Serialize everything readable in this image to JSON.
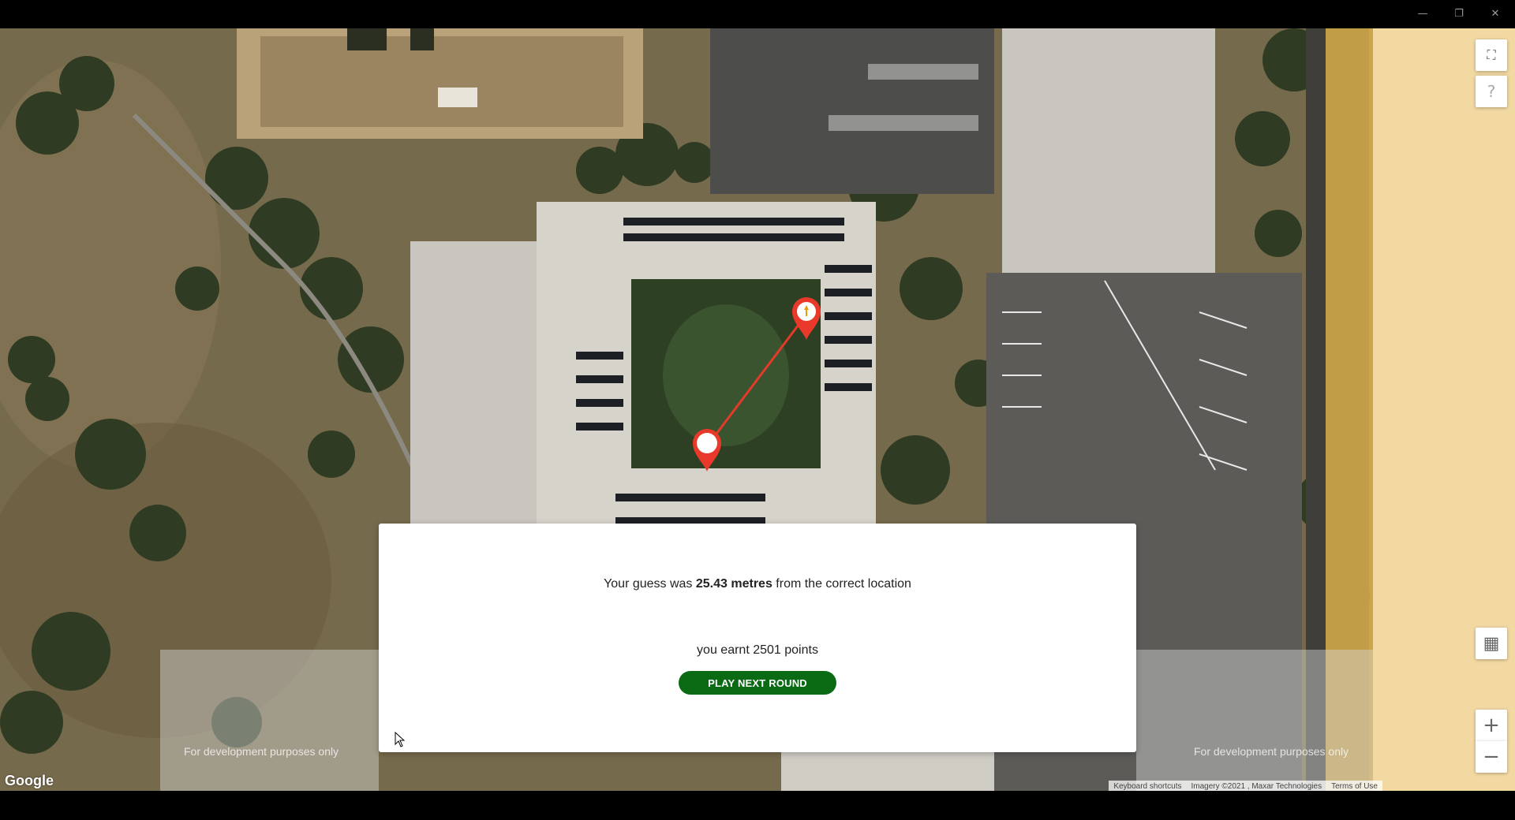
{
  "window": {
    "minimize_icon": "—",
    "restore_icon": "❐",
    "close_icon": "✕"
  },
  "map": {
    "google_label": "Google",
    "dev_watermark": "For development purposes only",
    "attribution": {
      "keyboard_shortcuts": "Keyboard shortcuts",
      "imagery": "Imagery ©2021 , Maxar Technologies",
      "terms": "Terms of Use"
    },
    "controls": {
      "fullscreen_icon": "⛶",
      "help_icon": "?",
      "layers_icon": "▦",
      "zoom_in": "+",
      "zoom_out": "−"
    },
    "colors": {
      "line": "#e53a2a",
      "marker": "#e8392b"
    }
  },
  "result": {
    "guess_prefix": "Your guess was ",
    "guess_distance": "25.43 metres",
    "guess_suffix": " from the correct location",
    "points_text": "you earnt 2501 points",
    "next_button": "PLAY NEXT ROUND",
    "button_color": "#0b6b14"
  }
}
